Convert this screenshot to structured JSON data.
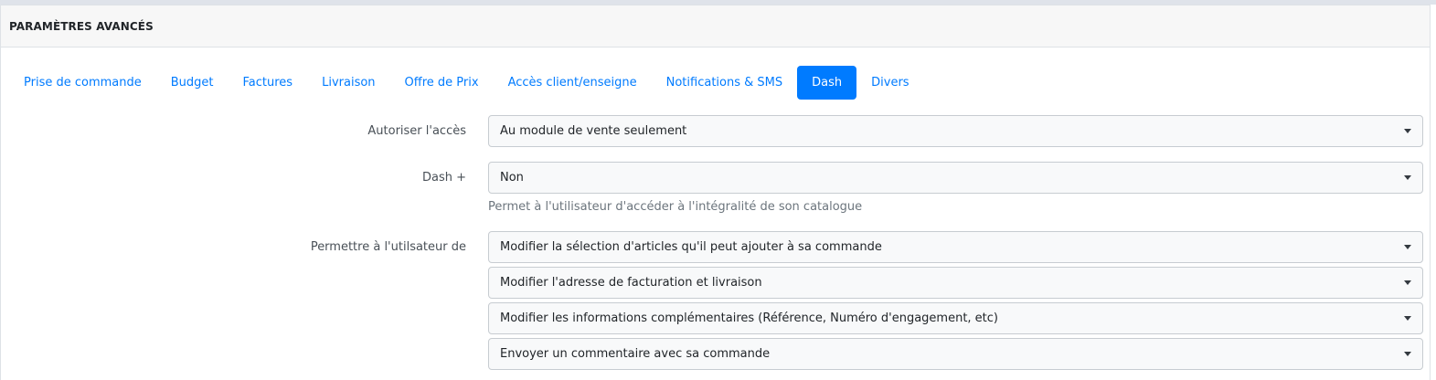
{
  "header": {
    "title": "PARAMÈTRES AVANCÉS"
  },
  "tabs": [
    {
      "label": "Prise de commande",
      "active": false
    },
    {
      "label": "Budget",
      "active": false
    },
    {
      "label": "Factures",
      "active": false
    },
    {
      "label": "Livraison",
      "active": false
    },
    {
      "label": "Offre de Prix",
      "active": false
    },
    {
      "label": "Accès client/enseigne",
      "active": false
    },
    {
      "label": "Notifications & SMS",
      "active": false
    },
    {
      "label": "Dash",
      "active": true
    },
    {
      "label": "Divers",
      "active": false
    }
  ],
  "form": {
    "access": {
      "label": "Autoriser l'accès",
      "value": "Au module de vente seulement"
    },
    "dash_plus": {
      "label": "Dash +",
      "value": "Non",
      "help": "Permet à l'utilisateur d'accéder à l'intégralité de son catalogue"
    },
    "permissions": {
      "label": "Permettre à l'utilsateur de",
      "selects": [
        "Modifier la sélection d'articles qu'il peut ajouter à sa commande",
        "Modifier l'adresse de facturation et livraison",
        "Modifier les informations complémentaires (Référence, Numéro d'engagement, etc)",
        "Envoyer un commentaire avec sa commande"
      ]
    }
  },
  "colors": {
    "accent": "#007bff",
    "header_bg": "#f7f7f7",
    "select_bg": "#f8f9fa",
    "help_text": "#6c757d"
  }
}
